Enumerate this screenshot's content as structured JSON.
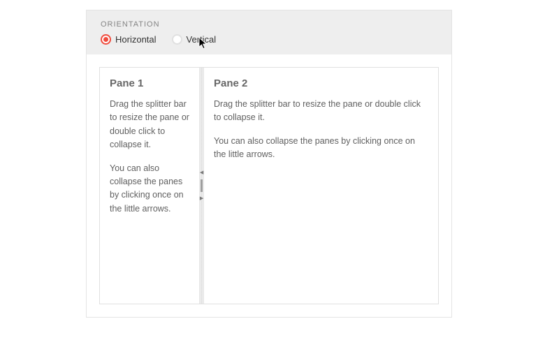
{
  "config": {
    "section_label": "ORIENTATION",
    "options": {
      "horizontal": "Horizontal",
      "vertical": "Vertical"
    },
    "selected": "horizontal"
  },
  "splitter": {
    "pane1": {
      "title": "Pane 1",
      "para1": "Drag the splitter bar to resize the pane or double click to collapse it.",
      "para2": "You can also collapse the panes by clicking once on the little arrows."
    },
    "pane2": {
      "title": "Pane 2",
      "para1": "Drag the splitter bar to resize the pane or double click to collapse it.",
      "para2": "You can also collapse the panes by clicking once on the little arrows."
    }
  }
}
